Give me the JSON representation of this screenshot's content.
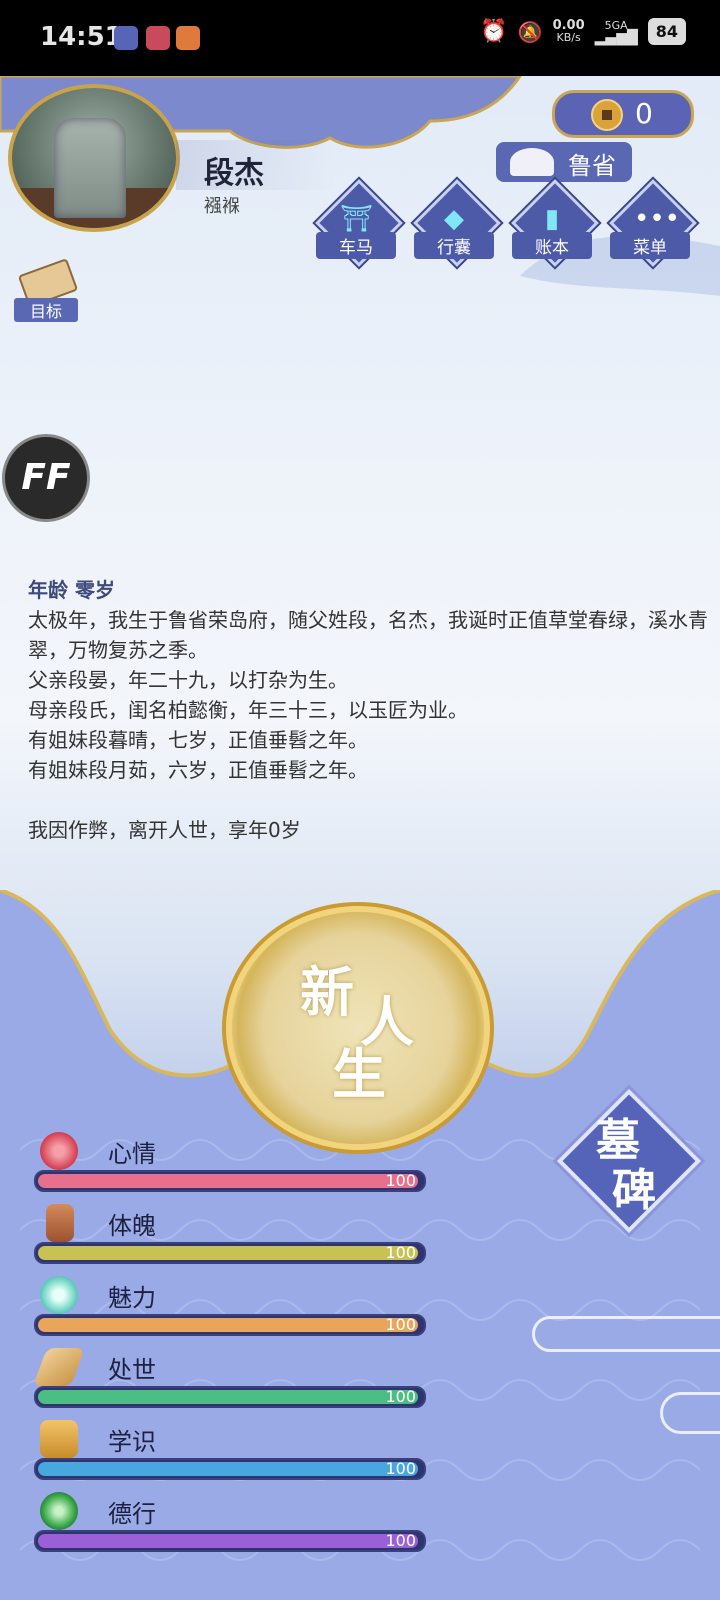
{
  "status_bar": {
    "time": "14:51",
    "speed": "0.00",
    "speed_unit": "KB/s",
    "network": "5GA",
    "battery": "84"
  },
  "player": {
    "name": "段杰",
    "stage": "襁褓"
  },
  "currency": {
    "value": "0"
  },
  "region": {
    "label": "鲁省"
  },
  "menu": [
    {
      "label": "车马",
      "icon": "carriage-icon"
    },
    {
      "label": "行囊",
      "icon": "bag-icon"
    },
    {
      "label": "账本",
      "icon": "ledger-icon"
    },
    {
      "label": "菜单",
      "icon": "more-icon"
    }
  ],
  "goal": {
    "label": "目标"
  },
  "ff_label": "FF",
  "story": {
    "age_line": "年龄 零岁",
    "lines": [
      "太极年，我生于鲁省荣岛府，随父姓段，名杰，我诞时正值草堂春绿，溪水青翠，万物复苏之季。",
      "父亲段晏，年二十九，以打杂为生。",
      "母亲段氏，闺名柏懿衡，年三十三，以玉匠为业。",
      "有姐妹段暮晴，七岁，正值垂髫之年。",
      "有姐妹段月茹，六岁，正值垂髫之年。"
    ],
    "death_line": "我因作弊，离开人世，享年0岁"
  },
  "new_life": {
    "c1": "新",
    "c2": "人",
    "c3": "生"
  },
  "tomb_button": {
    "c1": "墓",
    "c2": "碑"
  },
  "stats": [
    {
      "label": "心情",
      "value": 100,
      "max": 100,
      "color": "#e9708d",
      "icon": "flower-icon"
    },
    {
      "label": "体魄",
      "value": 100,
      "max": 100,
      "color": "#c8c255",
      "icon": "training-dummy-icon"
    },
    {
      "label": "魅力",
      "value": 100,
      "max": 100,
      "color": "#e9a65a",
      "icon": "mirror-icon"
    },
    {
      "label": "处世",
      "value": 100,
      "max": 100,
      "color": "#4dbe83",
      "icon": "tools-icon"
    },
    {
      "label": "学识",
      "value": 100,
      "max": 100,
      "color": "#48a8dd",
      "icon": "books-icon"
    },
    {
      "label": "德行",
      "value": 100,
      "max": 100,
      "color": "#9b5fd8",
      "icon": "jade-pendant-icon"
    }
  ]
}
